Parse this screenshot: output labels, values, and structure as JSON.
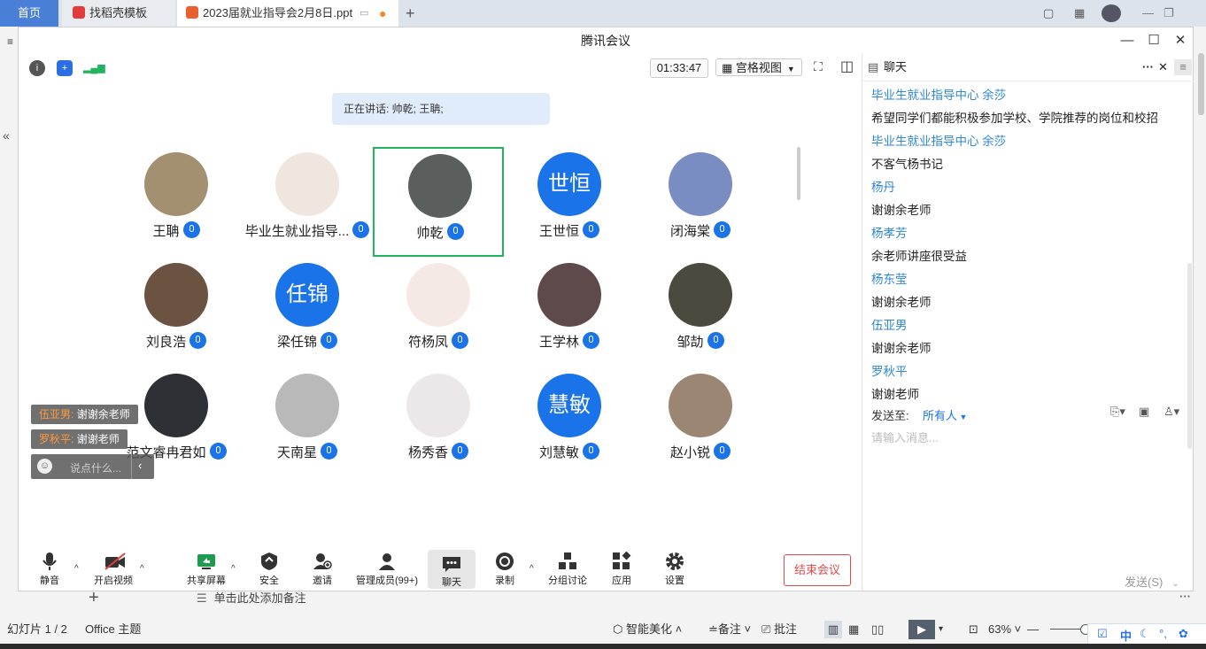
{
  "tabs": {
    "home": "首页",
    "template": "找稻壳模板",
    "ppt": "2023届就业指导会2月8日.ppt",
    "add": "+"
  },
  "meeting": {
    "title": "腾讯会议",
    "timer": "01:33:47",
    "view_mode": "宫格视图",
    "speaking": "正在讲话: 帅乾; 王聃;",
    "participants": [
      {
        "name": "王聃",
        "avatar_type": "photo",
        "color": "#a39070"
      },
      {
        "name": "毕业生就业指导...",
        "avatar_type": "photo",
        "color": "#f0e6e0"
      },
      {
        "name": "帅乾",
        "avatar_type": "photo",
        "color": "#5a5f5e"
      },
      {
        "name": "王世恒",
        "avatar_type": "text",
        "avatar_text": "世恒"
      },
      {
        "name": "闭海棠",
        "avatar_type": "photo",
        "color": "#7a8dc2"
      },
      {
        "name": "刘良浩",
        "avatar_type": "photo",
        "color": "#6b5241"
      },
      {
        "name": "梁任锦",
        "avatar_type": "text",
        "avatar_text": "任锦"
      },
      {
        "name": "符杨凤",
        "avatar_type": "photo",
        "color": "#f5e9e6"
      },
      {
        "name": "王学林",
        "avatar_type": "photo",
        "color": "#5e4a4a"
      },
      {
        "name": "邹劼",
        "avatar_type": "photo",
        "color": "#4b4a3e"
      },
      {
        "name": "范文睿冉君如",
        "avatar_type": "photo",
        "color": "#2e3035"
      },
      {
        "name": "天南星",
        "avatar_type": "photo",
        "color": "#b9b9b9"
      },
      {
        "name": "杨秀香",
        "avatar_type": "photo",
        "color": "#ece8ea"
      },
      {
        "name": "刘慧敏",
        "avatar_type": "text",
        "avatar_text": "慧敏"
      },
      {
        "name": "赵小锐",
        "avatar_type": "photo",
        "color": "#9a8672"
      }
    ],
    "float_chat": [
      {
        "name": "伍亚男:",
        "text": "谢谢余老师"
      },
      {
        "name": "罗秋平:",
        "text": "谢谢老师"
      }
    ],
    "say_placeholder": "说点什么...",
    "toolbar": {
      "mute": "静音",
      "video": "开启视频",
      "share": "共享屏幕",
      "security": "安全",
      "invite": "邀请",
      "members": "管理成员(99+)",
      "chat": "聊天",
      "record": "录制",
      "breakout": "分组讨论",
      "apps": "应用",
      "settings": "设置",
      "end": "结束会议"
    }
  },
  "chat": {
    "title": "聊天",
    "messages": [
      {
        "type": "name",
        "text": "毕业生就业指导中心 余莎"
      },
      {
        "type": "text",
        "text": "希望同学们都能积极参加学校、学院推荐的岗位和校招"
      },
      {
        "type": "name",
        "text": "毕业生就业指导中心 余莎"
      },
      {
        "type": "text",
        "text": "不客气杨书记"
      },
      {
        "type": "name",
        "text": "杨丹"
      },
      {
        "type": "text",
        "text": "谢谢余老师"
      },
      {
        "type": "name",
        "text": "杨孝芳"
      },
      {
        "type": "text",
        "text": "余老师讲座很受益"
      },
      {
        "type": "name",
        "text": "杨东莹"
      },
      {
        "type": "text",
        "text": "谢谢余老师"
      },
      {
        "type": "name",
        "text": "伍亚男"
      },
      {
        "type": "text",
        "text": "谢谢余老师"
      },
      {
        "type": "name",
        "text": "罗秋平"
      },
      {
        "type": "text",
        "text": "谢谢老师"
      }
    ],
    "send_to_label": "发送至:",
    "send_to_value": "所有人",
    "input_placeholder": "请输入消息...",
    "send_button": "发送(S)"
  },
  "ppt": {
    "notes_placeholder": "单击此处添加备注",
    "slide_info": "幻灯片 1 / 2",
    "theme": "Office 主题",
    "beautify": "智能美化",
    "notes_btn": "备注",
    "comments_btn": "批注",
    "zoom": "63%"
  },
  "ime": {
    "lang": "中"
  }
}
